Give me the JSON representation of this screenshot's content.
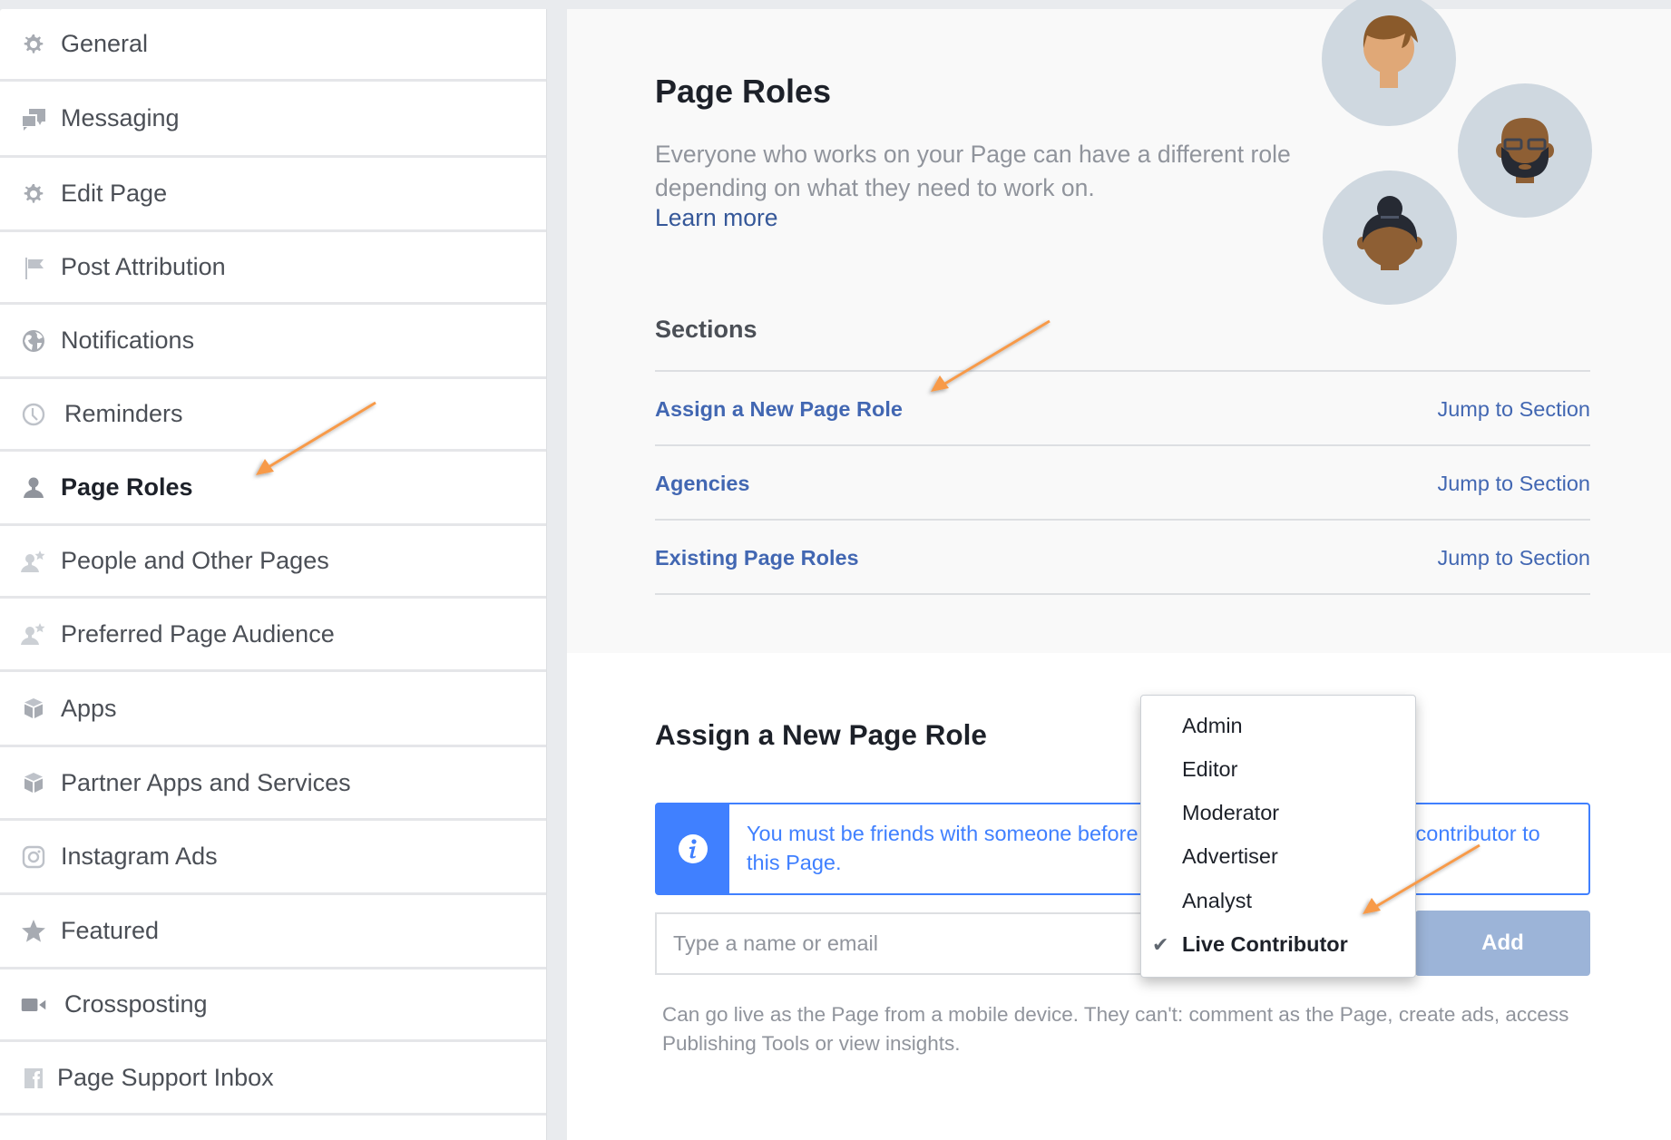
{
  "sidebar": {
    "items": [
      {
        "label": "General",
        "icon": "gear-icon"
      },
      {
        "label": "Messaging",
        "icon": "chat-bubbles-icon"
      },
      {
        "label": "Edit Page",
        "icon": "gear-icon"
      },
      {
        "label": "Post Attribution",
        "icon": "flag-icon"
      },
      {
        "label": "Notifications",
        "icon": "globe-icon"
      },
      {
        "label": "Reminders",
        "icon": "clock-icon"
      },
      {
        "label": "Page Roles",
        "icon": "person-icon",
        "active": true
      },
      {
        "label": "People and Other Pages",
        "icon": "person-star-icon"
      },
      {
        "label": "Preferred Page Audience",
        "icon": "person-star-icon"
      },
      {
        "label": "Apps",
        "icon": "cube-icon"
      },
      {
        "label": "Partner Apps and Services",
        "icon": "cube-icon"
      },
      {
        "label": "Instagram Ads",
        "icon": "instagram-icon"
      },
      {
        "label": "Featured",
        "icon": "star-icon"
      },
      {
        "label": "Crossposting",
        "icon": "video-camera-icon"
      },
      {
        "label": "Page Support Inbox",
        "icon": "facebook-icon"
      }
    ]
  },
  "header": {
    "title": "Page Roles",
    "description": "Everyone who works on your Page can have a different role depending on what they need to work on.",
    "learn_more": "Learn more"
  },
  "sections": {
    "heading": "Sections",
    "items": [
      {
        "label": "Assign a New Page Role",
        "jump": "Jump to Section"
      },
      {
        "label": "Agencies",
        "jump": "Jump to Section"
      },
      {
        "label": "Existing Page Roles",
        "jump": "Jump to Section"
      }
    ]
  },
  "assign": {
    "heading": "Assign a New Page Role",
    "info_text": "You must be friends with someone before you can add them as a live contributor to this Page.",
    "info_visible_left": "You must be friends with someone before",
    "info_visible_right": "contributor to",
    "info_line2": "this Page.",
    "input_placeholder": "Type a name or email",
    "add_label": "Add",
    "help_text": "Can go live as the Page from a mobile device. They can't: comment as the Page, create ads, access Publishing Tools or view insights.",
    "role_options": [
      "Admin",
      "Editor",
      "Moderator",
      "Advertiser",
      "Analyst",
      "Live Contributor"
    ],
    "selected_role": "Live Contributor"
  },
  "colors": {
    "link": "#4267b2",
    "info_blue": "#4080ff",
    "add_button": "#9cb4d8",
    "annotation_arrow": "#f79a4a"
  }
}
